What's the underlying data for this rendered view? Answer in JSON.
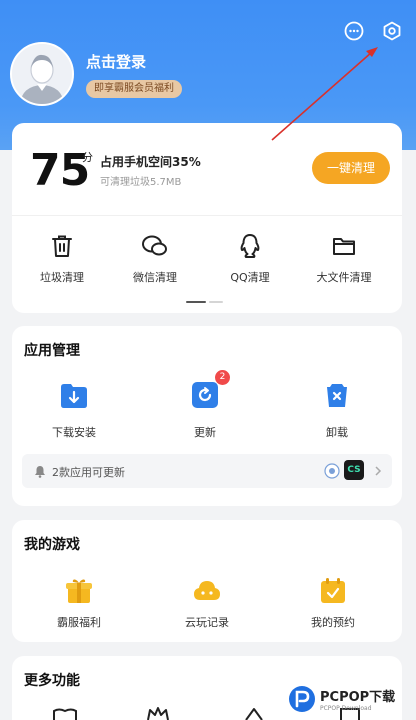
{
  "header": {
    "login_text": "点击登录",
    "vip_badge": "即享霸服会员福利"
  },
  "storage": {
    "score": "75",
    "score_unit": "分",
    "space_text": "占用手机空间35%",
    "junk_text": "可清理垃圾5.7MB",
    "clean_button": "一键清理"
  },
  "tools": [
    {
      "label": "垃圾清理",
      "icon": "trash-icon"
    },
    {
      "label": "微信清理",
      "icon": "wechat-icon"
    },
    {
      "label": "QQ清理",
      "icon": "qq-icon"
    },
    {
      "label": "大文件清理",
      "icon": "folder-icon"
    }
  ],
  "app_manage": {
    "title": "应用管理",
    "items": [
      {
        "label": "下载安装",
        "icon": "download-folder-icon"
      },
      {
        "label": "更新",
        "icon": "update-icon",
        "badge": "2"
      },
      {
        "label": "卸载",
        "icon": "uninstall-icon"
      }
    ],
    "update_notice": "2款应用可更新",
    "update_app_label": "CS"
  },
  "my_games": {
    "title": "我的游戏",
    "items": [
      {
        "label": "霸服福利",
        "icon": "gift-icon"
      },
      {
        "label": "云玩记录",
        "icon": "cloud-gamepad-icon"
      },
      {
        "label": "我的预约",
        "icon": "calendar-check-icon"
      }
    ]
  },
  "more": {
    "title": "更多功能"
  },
  "watermark": {
    "brand": "PCPOP下载",
    "sub": "PCPOP Download"
  },
  "colors": {
    "header_blue": "#3f8ff5",
    "accent_orange": "#f5a623",
    "icon_blue": "#2f7fe8",
    "game_yellow": "#f5b820",
    "badge_red": "#f04a4a"
  }
}
